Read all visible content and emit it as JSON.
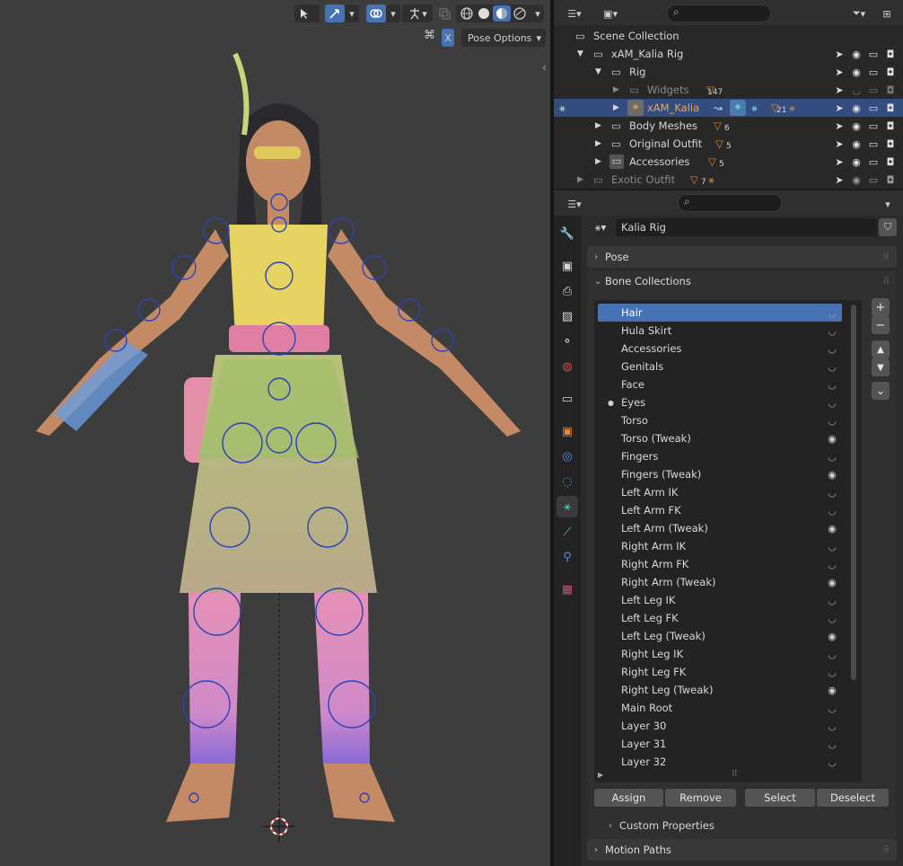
{
  "viewport": {
    "pose_options_label": "Pose Options",
    "x_badge": "X"
  },
  "outliner": {
    "rows": [
      {
        "label": "Scene Collection"
      },
      {
        "label": "xAM_Kalia Rig"
      },
      {
        "label": "Rig"
      },
      {
        "label": "Widgets",
        "count": "147"
      },
      {
        "label": "xAM_Kalia",
        "count": "21"
      },
      {
        "label": "Body Meshes",
        "count": "6"
      },
      {
        "label": "Original Outfit",
        "count": "5"
      },
      {
        "label": "Accessories",
        "count": "5"
      },
      {
        "label": "Exotic Outfit",
        "count": "7"
      }
    ]
  },
  "properties": {
    "object_name": "Kalia Rig",
    "panels": {
      "pose": "Pose",
      "bone_collections": "Bone Collections",
      "custom_properties": "Custom Properties",
      "motion_paths": "Motion Paths"
    },
    "bone_collections": [
      {
        "name": "Hair",
        "visible": "hidden",
        "selected": true
      },
      {
        "name": "Hula Skirt",
        "visible": "hidden"
      },
      {
        "name": "Accessories",
        "visible": "hidden"
      },
      {
        "name": "Genitals",
        "visible": "hidden"
      },
      {
        "name": "Face",
        "visible": "hidden"
      },
      {
        "name": "Eyes",
        "visible": "hidden",
        "dot": true
      },
      {
        "name": "Torso",
        "visible": "hidden"
      },
      {
        "name": "Torso (Tweak)",
        "visible": "shown"
      },
      {
        "name": "Fingers",
        "visible": "hidden"
      },
      {
        "name": "Fingers (Tweak)",
        "visible": "shown"
      },
      {
        "name": "Left Arm IK",
        "visible": "hidden"
      },
      {
        "name": "Left Arm FK",
        "visible": "hidden"
      },
      {
        "name": "Left Arm (Tweak)",
        "visible": "shown"
      },
      {
        "name": "Right Arm IK",
        "visible": "hidden"
      },
      {
        "name": "Right Arm FK",
        "visible": "hidden"
      },
      {
        "name": "Right Arm (Tweak)",
        "visible": "shown"
      },
      {
        "name": "Left Leg IK",
        "visible": "hidden"
      },
      {
        "name": "Left Leg FK",
        "visible": "hidden"
      },
      {
        "name": "Left Leg (Tweak)",
        "visible": "shown"
      },
      {
        "name": "Right Leg IK",
        "visible": "hidden"
      },
      {
        "name": "Right Leg FK",
        "visible": "hidden"
      },
      {
        "name": "Right Leg (Tweak)",
        "visible": "shown"
      },
      {
        "name": "Main Root",
        "visible": "hidden"
      },
      {
        "name": "Layer 30",
        "visible": "hidden"
      },
      {
        "name": "Layer 31",
        "visible": "hidden"
      },
      {
        "name": "Layer 32",
        "visible": "hidden"
      }
    ],
    "buttons": {
      "assign": "Assign",
      "remove": "Remove",
      "select": "Select",
      "deselect": "Deselect"
    }
  },
  "icons": {
    "eye_shown": "eye-icon",
    "eye_hidden": "eye-closed-icon"
  },
  "colors": {
    "accent": "#4772b3",
    "outliner_selected": "#334d80",
    "active_name": "#f0a64a"
  }
}
